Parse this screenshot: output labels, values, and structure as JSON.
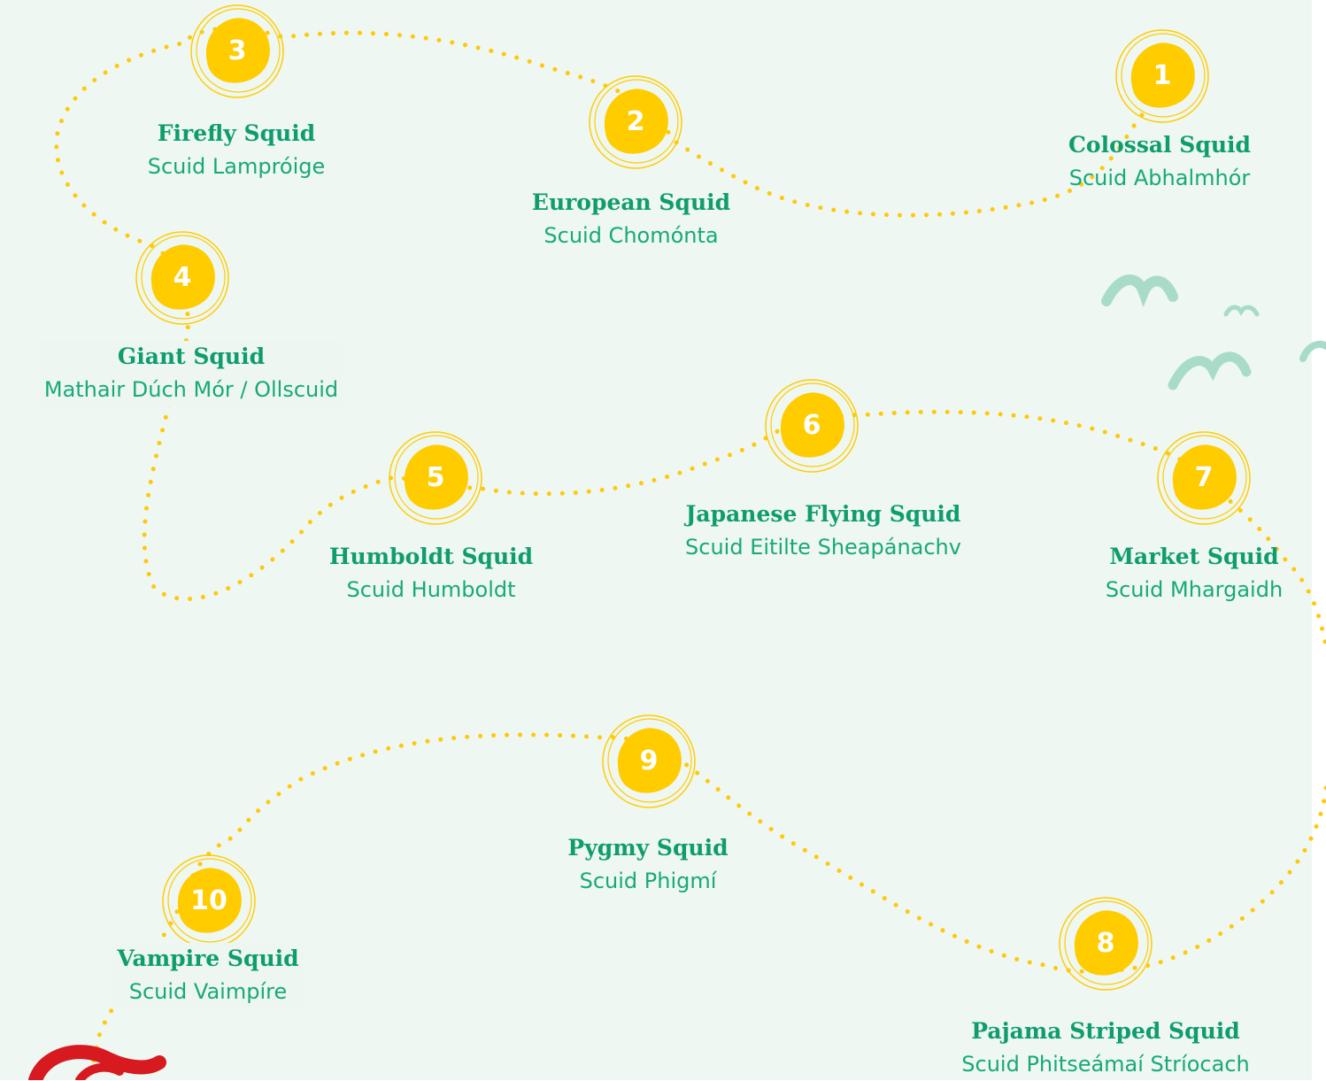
{
  "colors": {
    "background": "#eef7f2",
    "badge": "#ffcc00",
    "path_dots": "#ffc90a",
    "title_green": "#0f9d6e",
    "subtitle_green": "#18a979",
    "bird_green": "#a8dcc9",
    "ribbon_red": "#d71920"
  },
  "stops": [
    {
      "number": "1",
      "name_en": "Colossal Squid",
      "name_ga": "Scuid Abhalmhór"
    },
    {
      "number": "2",
      "name_en": "European Squid",
      "name_ga": "Scuid Chomónta"
    },
    {
      "number": "3",
      "name_en": "Firefly Squid",
      "name_ga": "Scuid Lampróige"
    },
    {
      "number": "4",
      "name_en": "Giant Squid",
      "name_ga": "Mathair Dúch Mór / Ollscuid"
    },
    {
      "number": "5",
      "name_en": "Humboldt Squid",
      "name_ga": "Scuid Humboldt"
    },
    {
      "number": "6",
      "name_en": "Japanese Flying Squid",
      "name_ga": "Scuid Eitilte Sheapánachv"
    },
    {
      "number": "7",
      "name_en": "Market Squid",
      "name_ga": "Scuid Mhargaidh"
    },
    {
      "number": "8",
      "name_en": "Pajama Striped Squid",
      "name_ga": "Scuid Phitseámaí Stríocach"
    },
    {
      "number": "9",
      "name_en": "Pygmy Squid",
      "name_ga": "Scuid Phigmí"
    },
    {
      "number": "10",
      "name_en": "Vampire Squid",
      "name_ga": "Scuid Vaimpíre"
    }
  ],
  "decorations": {
    "bird_icons": [
      "bird-icon",
      "bird-icon",
      "bird-icon",
      "bird-icon"
    ],
    "ribbon_icon": "squid-tentacle-icon"
  }
}
